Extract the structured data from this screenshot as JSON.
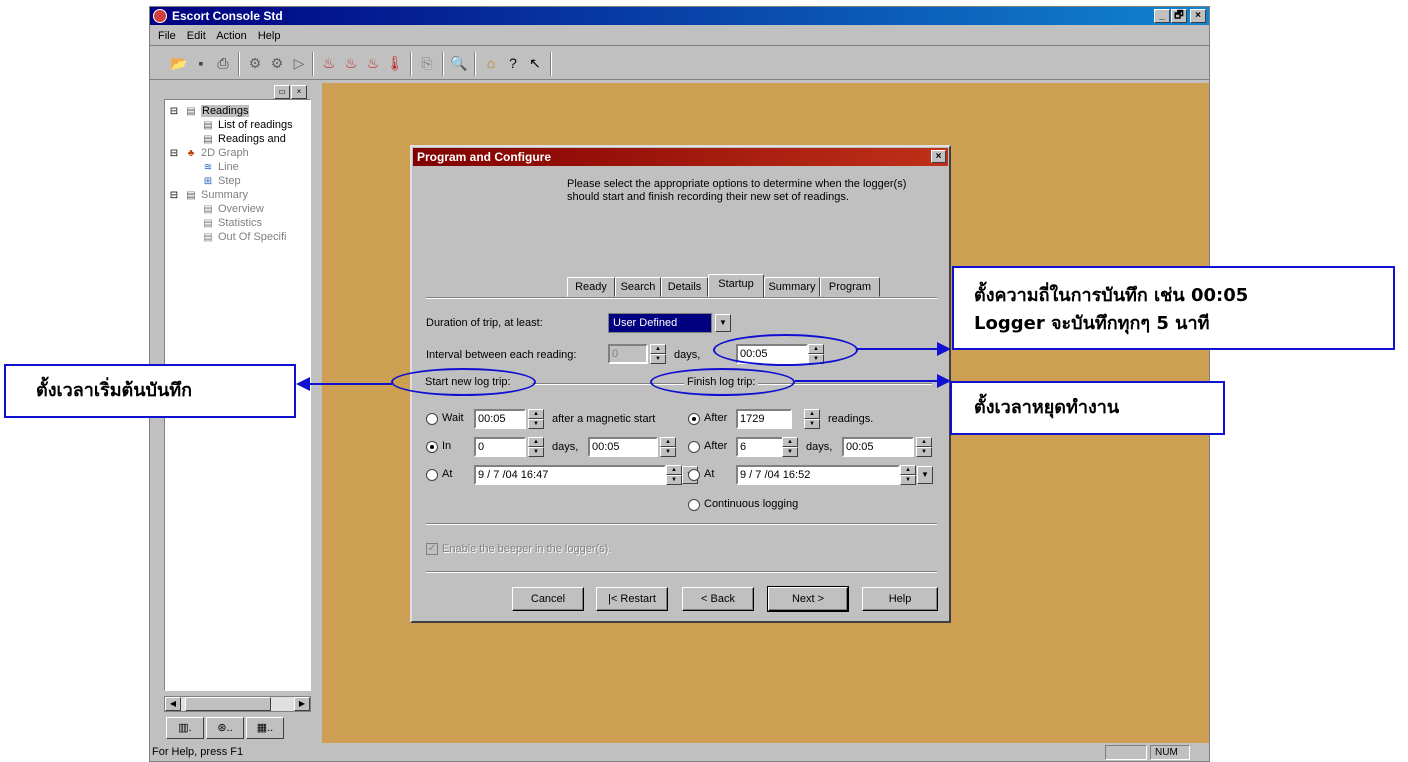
{
  "window": {
    "title": "Escort Console Std",
    "controls": [
      "_",
      "🗗",
      "×"
    ]
  },
  "menu": [
    "File",
    "Edit",
    "Action",
    "Help"
  ],
  "tree": {
    "items": [
      {
        "label": "Readings",
        "level": 0,
        "selected": true
      },
      {
        "label": "List of readings",
        "level": 1
      },
      {
        "label": "Readings and",
        "level": 1
      },
      {
        "label": "2D Graph",
        "level": 0
      },
      {
        "label": "Line",
        "level": 1
      },
      {
        "label": "Step",
        "level": 1
      },
      {
        "label": "Summary",
        "level": 0
      },
      {
        "label": "Overview",
        "level": 1
      },
      {
        "label": "Statistics",
        "level": 1
      },
      {
        "label": "Out Of Specifi",
        "level": 1
      }
    ]
  },
  "statusbar": {
    "help": "For Help, press F1",
    "num": "NUM"
  },
  "dialog": {
    "title": "Program and Configure",
    "intro": "Please select the appropriate options to determine when the logger(s) should start and finish recording their new set of readings.",
    "tabs": [
      "Ready",
      "Search",
      "Details",
      "Startup",
      "Summary",
      "Program"
    ],
    "active_tab": "Startup",
    "duration_label": "Duration of trip, at least:",
    "duration_value": "User Defined",
    "interval_label": "Interval between each reading:",
    "interval_days": "0",
    "days_label": "days,",
    "interval_time": "00:05",
    "start_group": "Start new log trip:",
    "finish_group": "Finish log trip:",
    "start": {
      "wait_label": "Wait",
      "wait_value": "00:05",
      "wait_suffix": "after a magnetic start",
      "in_label": "In",
      "in_days": "0",
      "in_days_label": "days,",
      "in_time": "00:05",
      "at_label": "At",
      "at_value": "9 / 7 /04  16:47",
      "selected": "in"
    },
    "finish": {
      "after_label": "After",
      "readings_value": "1729",
      "readings_suffix": "readings.",
      "after2_label": "After",
      "days_value": "6",
      "days_label": "days,",
      "time_value": "00:05",
      "at_label": "At",
      "at_value": "9 / 7 /04  16:52",
      "continuous_label": "Continuous logging",
      "selected": "readings"
    },
    "beeper_label": "Enable the beeper in the logger(s).",
    "buttons": {
      "cancel": "Cancel",
      "restart": "|< Restart",
      "back": "< Back",
      "next": "Next >",
      "help": "Help"
    }
  },
  "annotations": {
    "interval_note_line1": "ตั้งความถี่ในการบันทึก เช่น 00:05",
    "interval_note_line2": "Logger จะบันทึกทุกๆ 5 นาที",
    "start_note": "ตั้งเวลาเริ่มต้นบันทึก",
    "finish_note": "ตั้งเวลาหยุดทำงาน",
    "color": "#1010d0"
  },
  "colors": {
    "workspace": "#cc9f52",
    "title_active": "#000080",
    "dialog_title": "#800000"
  }
}
